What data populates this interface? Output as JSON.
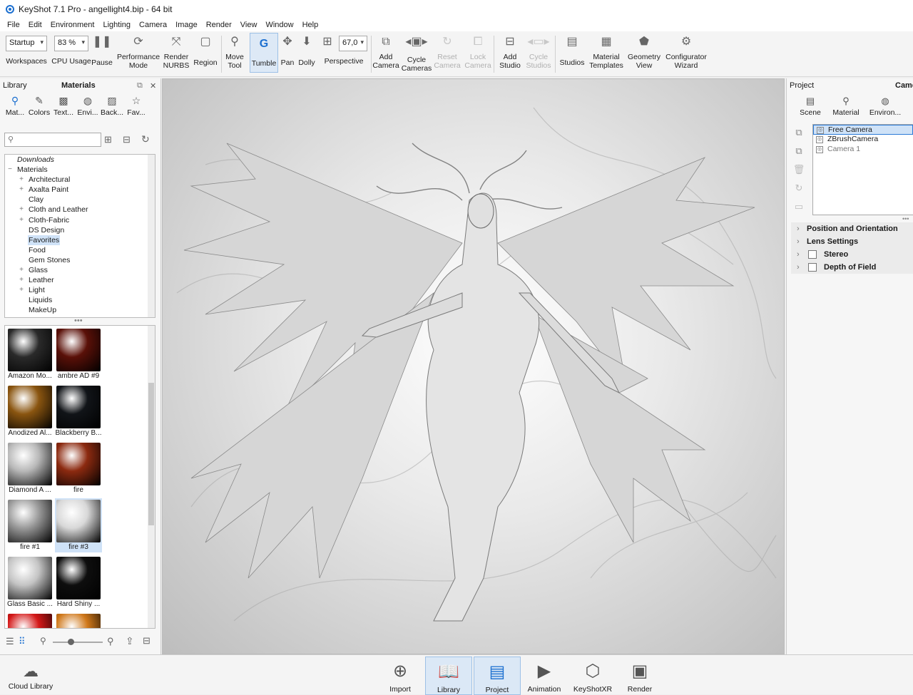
{
  "window": {
    "title": "KeyShot 7.1 Pro  -  angellight4.bip  -  64 bit"
  },
  "menu": [
    "File",
    "Edit",
    "Environment",
    "Lighting",
    "Camera",
    "Image",
    "Render",
    "View",
    "Window",
    "Help"
  ],
  "toolbar": {
    "workspace_value": "Startup",
    "workspaces_label": "Workspaces",
    "cpu_value": "83 %",
    "cpu_label": "CPU Usage",
    "fov_value": "67,0",
    "buttons": [
      {
        "label": "Pause",
        "icon": "pause-icon"
      },
      {
        "label": "Performance\nMode",
        "icon": "performance-icon"
      },
      {
        "label": "Render\nNURBS",
        "icon": "nurbs-icon"
      },
      {
        "label": "Region",
        "icon": "region-icon"
      },
      {
        "label": "Move\nTool",
        "icon": "move-tool-icon"
      },
      {
        "label": "Tumble",
        "icon": "tumble-icon"
      },
      {
        "label": "Pan",
        "icon": "pan-icon"
      },
      {
        "label": "Dolly",
        "icon": "dolly-icon"
      },
      {
        "label": "Perspective",
        "icon": "perspective-icon"
      },
      {
        "label": "Add\nCamera",
        "icon": "add-camera-icon"
      },
      {
        "label": "Cycle\nCameras",
        "icon": "cycle-cameras-icon"
      },
      {
        "label": "Reset\nCamera",
        "icon": "reset-camera-icon"
      },
      {
        "label": "Lock\nCamera",
        "icon": "lock-camera-icon"
      },
      {
        "label": "Add\nStudio",
        "icon": "add-studio-icon"
      },
      {
        "label": "Cycle\nStudios",
        "icon": "cycle-studios-icon"
      },
      {
        "label": "Studios",
        "icon": "studios-icon"
      },
      {
        "label": "Material\nTemplates",
        "icon": "material-templates-icon"
      },
      {
        "label": "Geometry\nView",
        "icon": "geometry-view-icon"
      },
      {
        "label": "Configurator\nWizard",
        "icon": "configurator-icon"
      }
    ]
  },
  "library": {
    "panel_title": "Library",
    "header": "Materials",
    "tabs": [
      "Mat...",
      "Colors",
      "Text...",
      "Envi...",
      "Back...",
      "Fav..."
    ],
    "tree": [
      {
        "label": "Downloads",
        "indent": 0,
        "expander": "",
        "italic": true
      },
      {
        "label": "Materials",
        "indent": 0,
        "expander": "−"
      },
      {
        "label": "Architectural",
        "indent": 1,
        "expander": "+"
      },
      {
        "label": "Axalta Paint",
        "indent": 1,
        "expander": "+"
      },
      {
        "label": "Clay",
        "indent": 1,
        "expander": ""
      },
      {
        "label": "Cloth and Leather",
        "indent": 1,
        "expander": "+"
      },
      {
        "label": "Cloth-Fabric",
        "indent": 1,
        "expander": "+"
      },
      {
        "label": "DS Design",
        "indent": 1,
        "expander": ""
      },
      {
        "label": "Favorites",
        "indent": 1,
        "expander": "",
        "selected": true
      },
      {
        "label": "Food",
        "indent": 1,
        "expander": ""
      },
      {
        "label": "Gem Stones",
        "indent": 1,
        "expander": ""
      },
      {
        "label": "Glass",
        "indent": 1,
        "expander": "+"
      },
      {
        "label": "Leather",
        "indent": 1,
        "expander": "+"
      },
      {
        "label": "Light",
        "indent": 1,
        "expander": "+"
      },
      {
        "label": "Liquids",
        "indent": 1,
        "expander": ""
      },
      {
        "label": "MakeUp",
        "indent": 1,
        "expander": ""
      }
    ],
    "thumbs": [
      {
        "label": "Amazon Mo...",
        "color": "#2a2a2a"
      },
      {
        "label": "ambre AD #9",
        "color": "#5a1008"
      },
      {
        "label": "Anodized Al...",
        "color": "#8a5510"
      },
      {
        "label": "Blackberry B...",
        "color": "#111418"
      },
      {
        "label": "Diamond A ...",
        "color": "#b8b8b8"
      },
      {
        "label": "fire",
        "color": "#8c2a10"
      },
      {
        "label": "fire #1",
        "color": "#9a9a9a"
      },
      {
        "label": "fire #3",
        "color": "#d8d8d8",
        "selected": true
      },
      {
        "label": "Glass Basic ...",
        "color": "#c4c4c4"
      },
      {
        "label": "Hard Shiny ...",
        "color": "#0e0e0e"
      },
      {
        "label": "",
        "color": "#d41818"
      },
      {
        "label": "",
        "color": "#d0781a"
      }
    ]
  },
  "project": {
    "panel_title": "Project",
    "header": "Came",
    "tabs": [
      "Scene",
      "Material",
      "Environ..."
    ],
    "cameras": [
      {
        "label": "Free Camera",
        "selected": true
      },
      {
        "label": "ZBrushCamera"
      },
      {
        "label": "Camera 1",
        "dim": true
      }
    ],
    "sections": [
      {
        "label": "Position and Orientation",
        "checkbox": false
      },
      {
        "label": "Lens Settings",
        "checkbox": false
      },
      {
        "label": "Stereo",
        "checkbox": true
      },
      {
        "label": "Depth of Field",
        "checkbox": true
      }
    ]
  },
  "bottom": {
    "cloud_label": "Cloud Library",
    "buttons": [
      {
        "label": "Import",
        "icon": "import-icon"
      },
      {
        "label": "Library",
        "icon": "library-book-icon",
        "active": true
      },
      {
        "label": "Project",
        "icon": "project-list-icon",
        "active": true
      },
      {
        "label": "Animation",
        "icon": "animation-play-icon"
      },
      {
        "label": "KeyShotXR",
        "icon": "keyshotxr-cube-icon"
      },
      {
        "label": "Render",
        "icon": "render-icon"
      }
    ]
  },
  "colors": {
    "accent": "#1b6fd0",
    "selection": "#cfe2f7"
  }
}
